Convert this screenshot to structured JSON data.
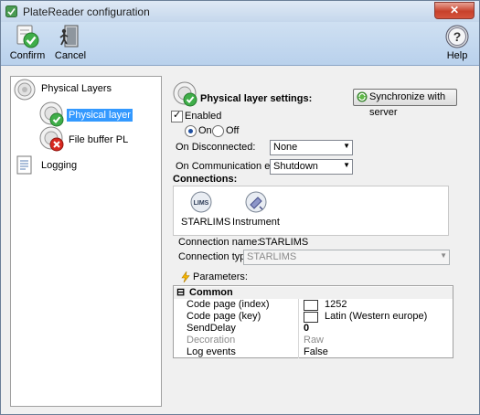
{
  "window": {
    "title": "PlateReader configuration",
    "close_label": "✕"
  },
  "toolbar": {
    "confirm_label": "Confirm",
    "cancel_label": "Cancel",
    "help_label": "Help"
  },
  "tree": {
    "items": [
      {
        "label": "Physical Layers"
      },
      {
        "label": "Physical layer"
      },
      {
        "label": "File buffer PL"
      },
      {
        "label": "Logging"
      }
    ]
  },
  "settings": {
    "heading": "Physical layer settings:",
    "sync_label": "Synchronize with server",
    "enabled_label": "Enabled",
    "enabled_checked": true,
    "on_label": "On",
    "off_label": "Off",
    "selected_state": "On",
    "on_disconnected_label": "On Disconnected:",
    "on_disconnected_value": "None",
    "on_comm_error_label": "On Communication error:",
    "on_comm_error_value": "Shutdown"
  },
  "connections": {
    "heading": "Connections:",
    "items": [
      {
        "label": "STARLIMS",
        "icon": "lims-icon"
      },
      {
        "label": "Instrument",
        "icon": "instrument-icon"
      }
    ],
    "name_label": "Connection name:",
    "name_value": "STARLIMS",
    "type_label": "Connection type:",
    "type_value": "STARLIMS"
  },
  "parameters": {
    "heading": "Parameters:",
    "group": "Common",
    "group_toggle": "⊟",
    "rows": [
      {
        "name": "Code page (index)",
        "value": "1252"
      },
      {
        "name": "Code page (key)",
        "value": "Latin (Western europe)"
      },
      {
        "name": "SendDelay",
        "value": "0"
      },
      {
        "name": "Decoration",
        "value": "Raw"
      },
      {
        "name": "Log events",
        "value": "False"
      }
    ]
  },
  "colors": {
    "selection": "#3399ff",
    "toolbar": "#c4d8ee",
    "check_green": "#3fae49",
    "error_red": "#d7261e"
  }
}
